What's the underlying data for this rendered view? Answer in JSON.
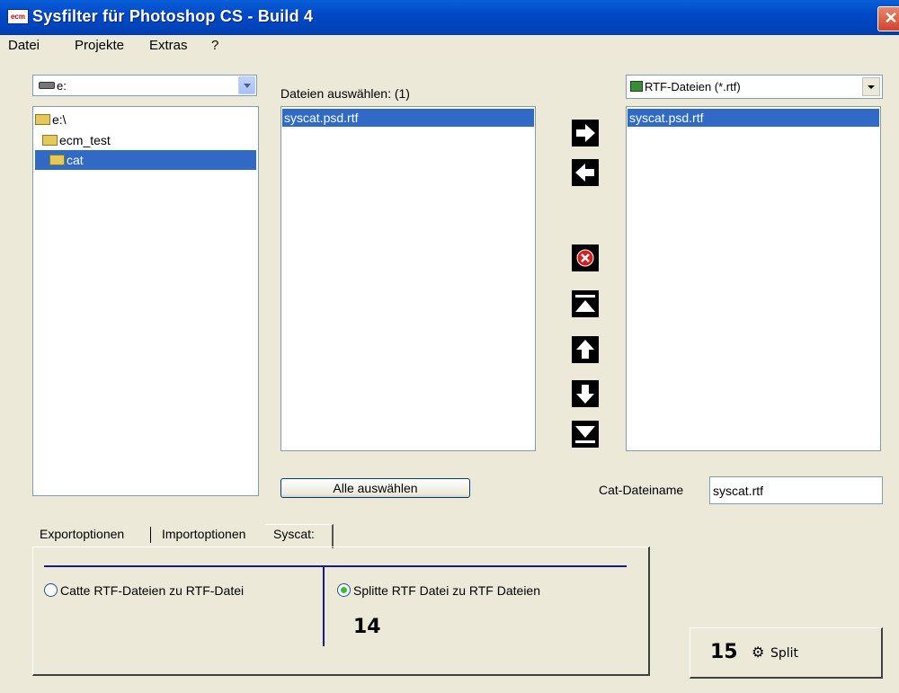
{
  "window": {
    "title": "Sysfilter für Photoshop CS - Build 4",
    "icon_text": "ecm"
  },
  "menu": [
    "Datei",
    "Projekte",
    "Extras",
    "?"
  ],
  "drive_combo": {
    "value": "e:"
  },
  "folder_tree": [
    {
      "label": "e:\\",
      "selected": false
    },
    {
      "label": "ecm_test",
      "selected": false
    },
    {
      "label": "cat",
      "selected": true
    }
  ],
  "files_panel": {
    "label": "Dateien auswählen: (1)",
    "items": [
      "syscat.psd.rtf"
    ],
    "select_all_label": "Alle auswählen"
  },
  "filter_combo": {
    "value": "RTF-Dateien (*.rtf)"
  },
  "selected_panel": {
    "items": [
      "syscat.psd.rtf"
    ]
  },
  "cat_filename": {
    "label": "Cat-Dateiname",
    "value": "syscat.rtf"
  },
  "tabs": [
    "Exportoptionen",
    "Importoptionen",
    "Syscat:"
  ],
  "syscat": {
    "option_cat": "Catte RTF-Dateien zu RTF-Datei",
    "option_split": "Splitte RTF Datei zu RTF Dateien",
    "annotation_14": "14"
  },
  "split_button": {
    "annotation": "15",
    "label": "Split"
  }
}
